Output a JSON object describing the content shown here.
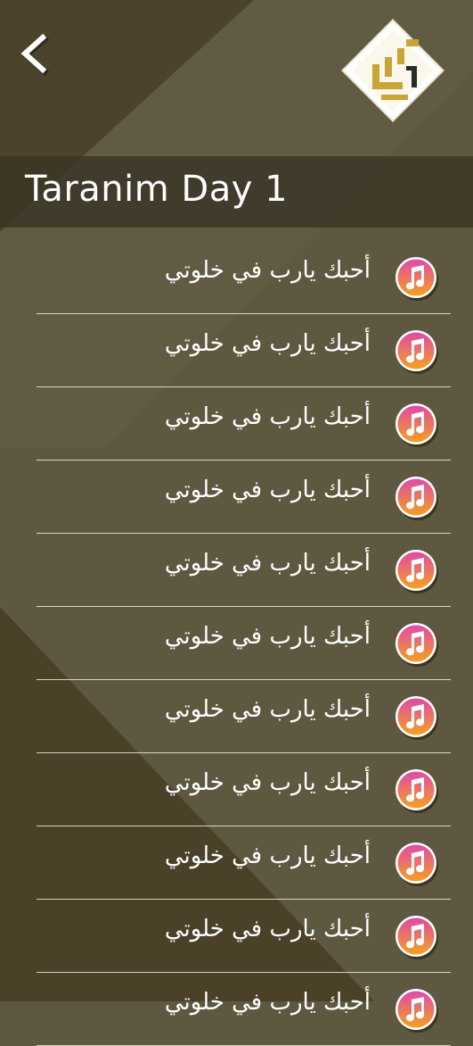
{
  "header": {
    "title": "Taranim Day 1",
    "back_icon": "chevron-left-icon",
    "logo_icon": "app-logo-icon"
  },
  "colors": {
    "background": "#5f5841",
    "dark_stripe": "#4a4128",
    "title_band": "#3a3426",
    "icon_gradient_top": "#e04aa8",
    "icon_gradient_bottom": "#f4a020"
  },
  "songs": [
    {
      "title": "أحبك يارب في خلوتي",
      "icon": "music-note-icon"
    },
    {
      "title": "أحبك يارب في خلوتي",
      "icon": "music-note-icon"
    },
    {
      "title": "أحبك يارب في خلوتي",
      "icon": "music-note-icon"
    },
    {
      "title": "أحبك يارب في خلوتي",
      "icon": "music-note-icon"
    },
    {
      "title": "أحبك يارب في خلوتي",
      "icon": "music-note-icon"
    },
    {
      "title": "أحبك يارب في خلوتي",
      "icon": "music-note-icon"
    },
    {
      "title": "أحبك يارب في خلوتي",
      "icon": "music-note-icon"
    },
    {
      "title": "أحبك يارب في خلوتي",
      "icon": "music-note-icon"
    },
    {
      "title": "أحبك يارب في خلوتي",
      "icon": "music-note-icon"
    },
    {
      "title": "أحبك يارب في خلوتي",
      "icon": "music-note-icon"
    },
    {
      "title": "أحبك يارب في خلوتي",
      "icon": "music-note-icon"
    }
  ]
}
